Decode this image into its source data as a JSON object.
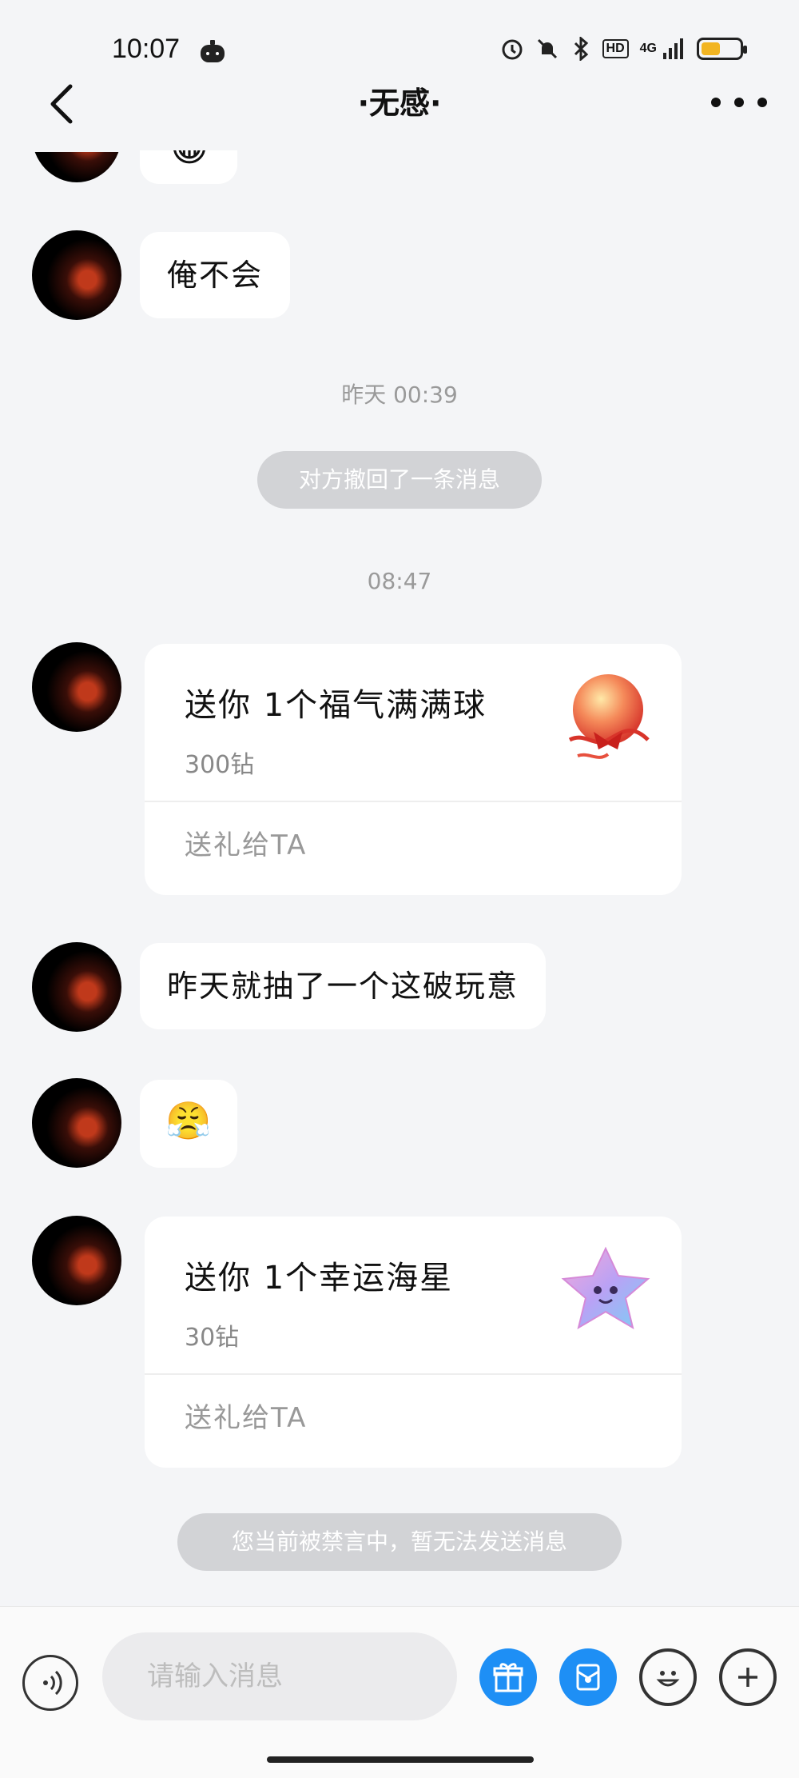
{
  "status_bar": {
    "time": "10:07",
    "network": "4G",
    "hd": "HD",
    "battery_level": 0.5
  },
  "header": {
    "title": "·无感·"
  },
  "messages": {
    "m1_emoji": "😁",
    "m2_text": "俺不会",
    "ts1": "昨天 00:39",
    "recall_notice": "对方撤回了一条消息",
    "ts2": "08:47",
    "gift1": {
      "title": "送你 1个福气满满球",
      "price": "300钻",
      "action": "送礼给TA"
    },
    "m4_text": "昨天就抽了一个这破玩意",
    "m5_emoji": "😤",
    "gift2": {
      "title": "送你 1个幸运海星",
      "price": "30钻",
      "action": "送礼给TA"
    },
    "mute_notice": "您当前被禁言中，暂无法发送消息"
  },
  "input": {
    "placeholder": "请输入消息"
  },
  "colors": {
    "accent_blue": "#1e8ff5",
    "background": "#f4f5f7",
    "system_pill": "#d2d3d6"
  }
}
